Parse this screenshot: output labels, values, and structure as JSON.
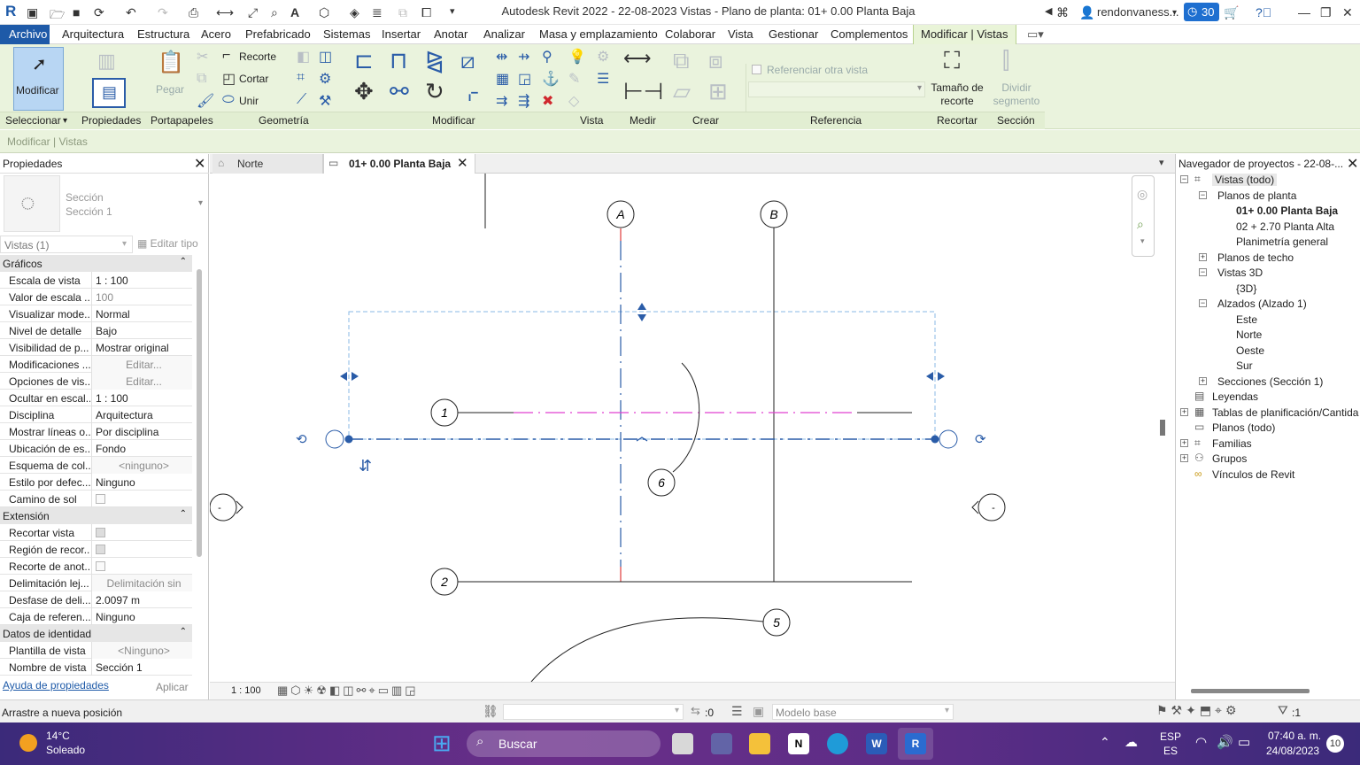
{
  "title_bar": {
    "title": "Autodesk Revit 2022 - 22-08-2023 Vistas - Plano de planta: 01+ 0.00 Planta Baja",
    "user": "rendonvaness...",
    "badge": "30",
    "logo_letter": "R"
  },
  "menu": {
    "items": [
      "Archivo",
      "Arquitectura",
      "Estructura",
      "Acero",
      "Prefabricado",
      "Sistemas",
      "Insertar",
      "Anotar",
      "Analizar",
      "Masa y emplazamiento",
      "Colaborar",
      "Vista",
      "Gestionar",
      "Complementos",
      "Modificar | Vistas"
    ]
  },
  "ribbon": {
    "modify_label": "Modificar",
    "clip_labels": [
      "Recorte",
      "Cortar",
      "Unir"
    ],
    "ref_checkbox": "Referenciar otra vista",
    "crop_size": "Tamaño de recorte",
    "split_segment": "Dividir segmento",
    "paste_label": "Pegar",
    "panels": [
      "Seleccionar",
      "Propiedades",
      "Portapapeles",
      "Geometría",
      "Modificar",
      "Vista",
      "Medir",
      "Crear",
      "Referencia",
      "Recortar",
      "Sección"
    ]
  },
  "options_bar": {
    "text": "Modificar | Vistas"
  },
  "properties": {
    "title": "Propiedades",
    "type_name": "Sección",
    "type_sub": "Sección 1",
    "filter": "Vistas (1)",
    "edit_type": "Editar tipo",
    "sections": [
      {
        "name": "Gráficos",
        "rows": [
          {
            "k": "Escala de vista",
            "v": "1 : 100",
            "style": ""
          },
          {
            "k": "Valor de escala ...",
            "v": "100",
            "style": "dim"
          },
          {
            "k": "Visualizar mode...",
            "v": "Normal",
            "style": ""
          },
          {
            "k": "Nivel de detalle",
            "v": "Bajo",
            "style": ""
          },
          {
            "k": "Visibilidad de p...",
            "v": "Mostrar original",
            "style": ""
          },
          {
            "k": "Modificaciones ...",
            "v": "Editar...",
            "style": "btn"
          },
          {
            "k": "Opciones de vis...",
            "v": "Editar...",
            "style": "btn"
          },
          {
            "k": "Ocultar en escal...",
            "v": "1 : 100",
            "style": ""
          },
          {
            "k": "Disciplina",
            "v": "Arquitectura",
            "style": ""
          },
          {
            "k": "Mostrar líneas o...",
            "v": "Por disciplina",
            "style": ""
          },
          {
            "k": "Ubicación de es...",
            "v": "Fondo",
            "style": ""
          },
          {
            "k": "Esquema de col...",
            "v": "<ninguno>",
            "style": "btn"
          },
          {
            "k": "Estilo por defec...",
            "v": "Ninguno",
            "style": ""
          },
          {
            "k": "Camino de sol",
            "v": "",
            "style": "chk"
          }
        ]
      },
      {
        "name": "Extensión",
        "rows": [
          {
            "k": "Recortar vista",
            "v": "",
            "style": "chkon"
          },
          {
            "k": "Región de recor...",
            "v": "",
            "style": "chkon"
          },
          {
            "k": "Recorte de anot...",
            "v": "",
            "style": "chk"
          },
          {
            "k": "Delimitación lej...",
            "v": "Delimitación sin",
            "style": "btn"
          },
          {
            "k": "Desfase de deli...",
            "v": "2.0097 m",
            "style": ""
          },
          {
            "k": "Caja de referen...",
            "v": "Ninguno",
            "style": ""
          }
        ]
      },
      {
        "name": "Datos de identidad",
        "rows": [
          {
            "k": "Plantilla de vista",
            "v": "<Ninguno>",
            "style": "btn"
          },
          {
            "k": "Nombre de vista",
            "v": "Sección 1",
            "style": ""
          }
        ]
      }
    ],
    "help_link": "Ayuda de propiedades",
    "apply": "Aplicar"
  },
  "view_tabs": [
    {
      "label": "Norte",
      "active": false
    },
    {
      "label": "01+ 0.00 Planta Baja",
      "active": true
    }
  ],
  "drawing": {
    "grid_labels": [
      "A",
      "B",
      "1",
      "2",
      "5",
      "6"
    ],
    "section_marks": [
      "-",
      "-"
    ]
  },
  "view_control": {
    "scale": "1 : 100"
  },
  "browser": {
    "title": "Navegador de proyectos - 22-08-...",
    "nodes": [
      {
        "label": "Vistas (todo)",
        "level": 0,
        "toggle": "-",
        "bold": false,
        "icon": "views-icon"
      },
      {
        "label": "Planos de planta",
        "level": 1,
        "toggle": "-",
        "bold": false
      },
      {
        "label": "01+ 0.00 Planta Baja",
        "level": 2,
        "toggle": "",
        "bold": true
      },
      {
        "label": "02 + 2.70 Planta Alta",
        "level": 2,
        "toggle": "",
        "bold": false
      },
      {
        "label": "Planimetría general",
        "level": 2,
        "toggle": "",
        "bold": false
      },
      {
        "label": "Planos de techo",
        "level": 1,
        "toggle": "+",
        "bold": false
      },
      {
        "label": "Vistas 3D",
        "level": 1,
        "toggle": "-",
        "bold": false
      },
      {
        "label": "{3D}",
        "level": 2,
        "toggle": "",
        "bold": false
      },
      {
        "label": "Alzados (Alzado 1)",
        "level": 1,
        "toggle": "-",
        "bold": false
      },
      {
        "label": "Este",
        "level": 2,
        "toggle": "",
        "bold": false
      },
      {
        "label": "Norte",
        "level": 2,
        "toggle": "",
        "bold": false
      },
      {
        "label": "Oeste",
        "level": 2,
        "toggle": "",
        "bold": false
      },
      {
        "label": "Sur",
        "level": 2,
        "toggle": "",
        "bold": false
      },
      {
        "label": "Secciones (Sección 1)",
        "level": 1,
        "toggle": "+",
        "bold": false
      },
      {
        "label": "Leyendas",
        "level": 0,
        "toggle": "",
        "bold": false,
        "icon": "legend-icon"
      },
      {
        "label": "Tablas de planificación/Cantida",
        "level": 0,
        "toggle": "+",
        "bold": false,
        "icon": "table-icon"
      },
      {
        "label": "Planos (todo)",
        "level": 0,
        "toggle": "",
        "bold": false,
        "icon": "sheet-icon"
      },
      {
        "label": "Familias",
        "level": 0,
        "toggle": "+",
        "bold": false,
        "icon": "family-icon"
      },
      {
        "label": "Grupos",
        "level": 0,
        "toggle": "+",
        "bold": false,
        "icon": "group-icon"
      },
      {
        "label": "Vínculos de Revit",
        "level": 0,
        "toggle": "",
        "bold": false,
        "icon": "link-icon"
      }
    ]
  },
  "status": {
    "hint": "Arrastre a nueva posición",
    "zero": ":0",
    "model": "Modelo base",
    "filter_count": ":1"
  },
  "taskbar": {
    "temp": "14°C",
    "weather": "Soleado",
    "search": "Buscar",
    "lang1": "ESP",
    "lang2": "ES",
    "time": "07:40 a. m.",
    "date": "24/08/2023",
    "notif": "10"
  }
}
